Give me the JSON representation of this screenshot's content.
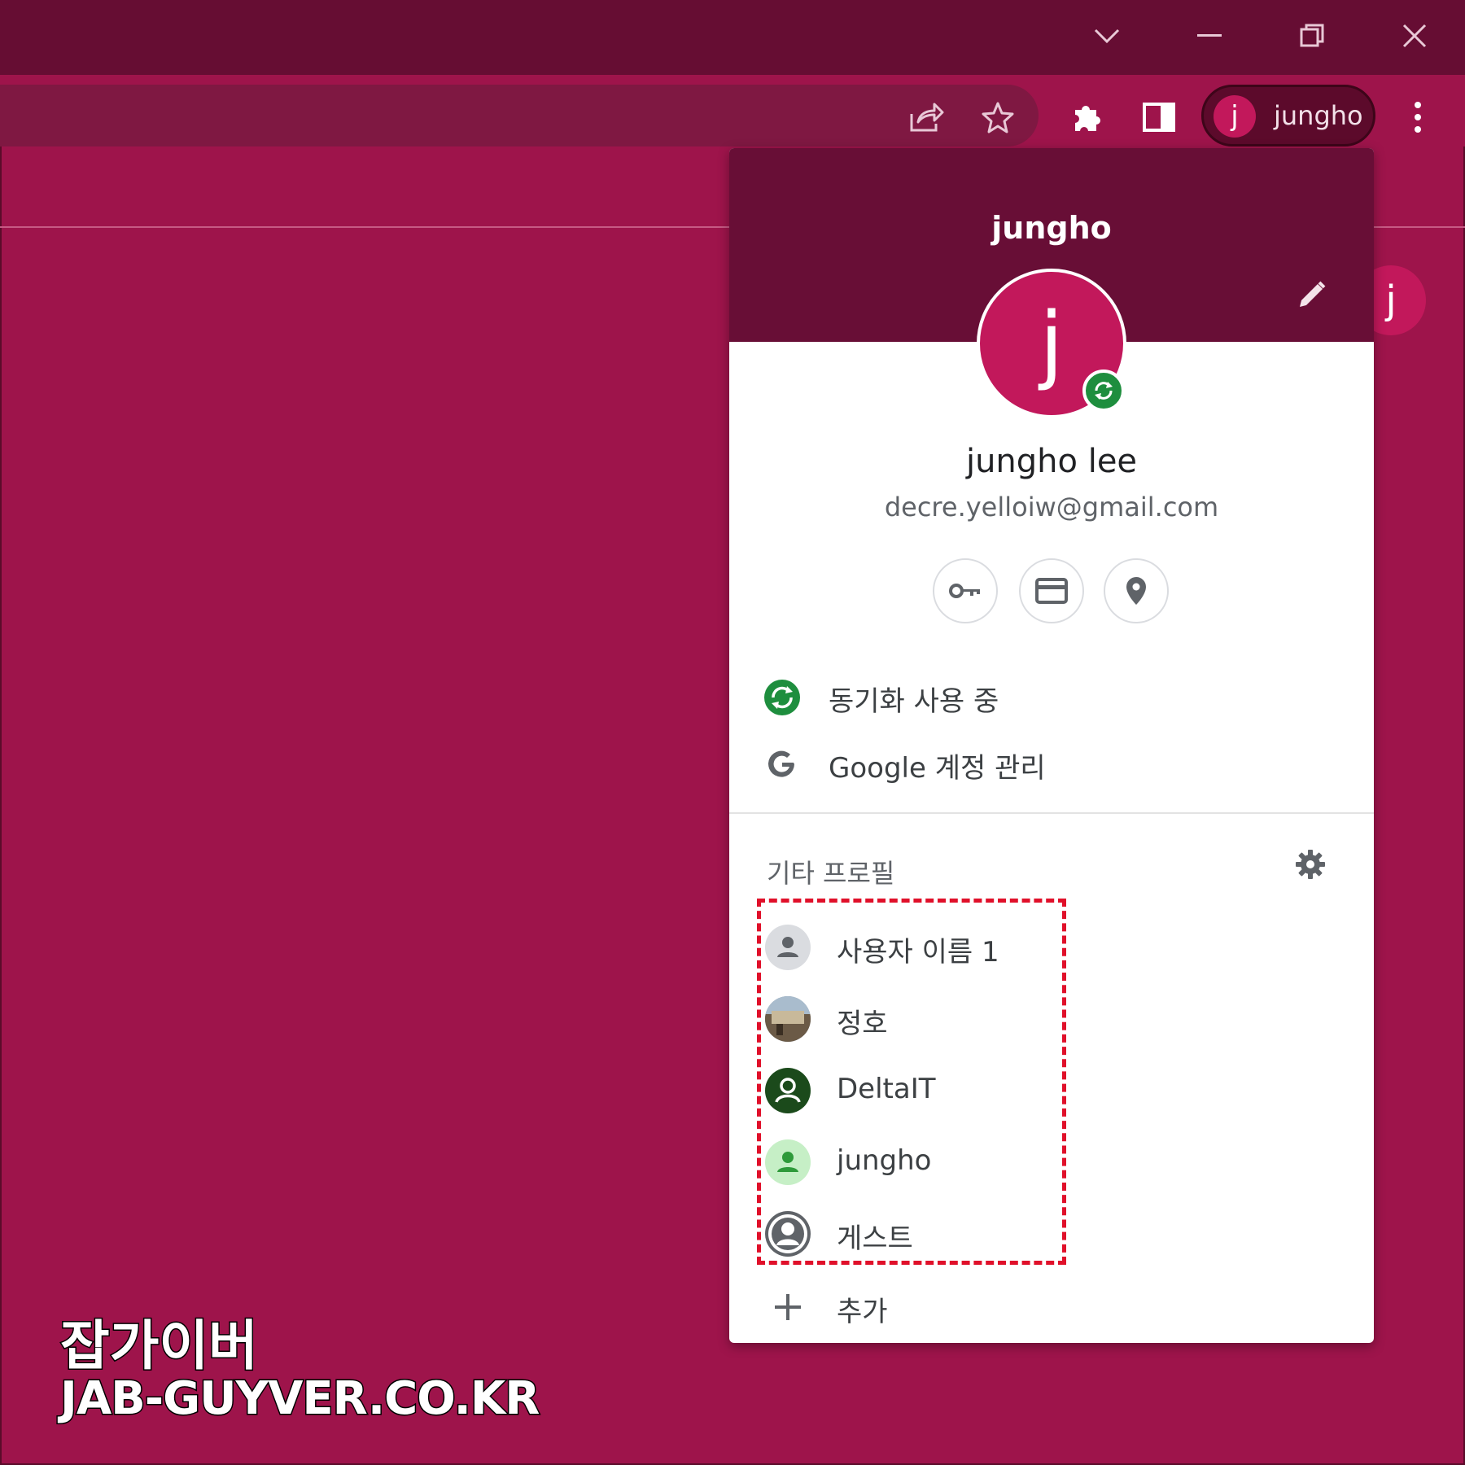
{
  "window": {
    "buttons": [
      "tab-search",
      "minimize",
      "restore",
      "close"
    ]
  },
  "toolbar": {
    "profile_chip": {
      "avatar_letter": "j",
      "name": "jungho"
    }
  },
  "background": {
    "avatar_letter": "j"
  },
  "popup": {
    "title": "jungho",
    "avatar_letter": "j",
    "full_name": "jungho lee",
    "email": "decre.yelloiw@gmail.com",
    "quick_buttons": [
      "key-icon",
      "card-icon",
      "location-pin-icon"
    ],
    "menu": [
      {
        "icon": "sync-icon",
        "label": "동기화 사용 중"
      },
      {
        "icon": "google-g-icon",
        "label": "Google 계정 관리"
      }
    ],
    "other_profiles_title": "기타 프로필",
    "profiles": [
      {
        "name": "사용자 이름 1",
        "avatar": "person-gray"
      },
      {
        "name": "정호",
        "avatar": "photo"
      },
      {
        "name": "DeltaIT",
        "avatar": "person-dark-green"
      },
      {
        "name": "jungho",
        "avatar": "person-light-green"
      },
      {
        "name": "게스트",
        "avatar": "guest"
      }
    ],
    "add_label": "추가"
  },
  "colors": {
    "accent": "#c2185b",
    "frame": "#660d33",
    "page": "#9e144b",
    "sync_green": "#1e8e3e",
    "highlight_dash": "#e0102a"
  },
  "watermark": {
    "line1": "잡가이버",
    "line2": "JAB-GUYVER.CO.KR"
  }
}
